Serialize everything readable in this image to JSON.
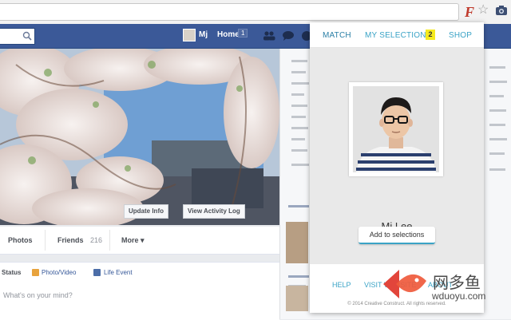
{
  "browser": {
    "extension_glyph": "F",
    "star_icon": "star-icon",
    "camera_icon": "camera-icon"
  },
  "facebook": {
    "user_name": "Mj",
    "home_label": "Home",
    "home_count": "1",
    "cover_buttons": {
      "update_info": "Update Info",
      "view_activity": "View Activity Log"
    },
    "tabs": {
      "photos": "Photos",
      "friends": "Friends",
      "friends_count": "216",
      "more": "More ▾"
    },
    "composer": {
      "status": "Status",
      "photo_video": "Photo/Video",
      "life_event": "Life Event",
      "placeholder": "What's on your mind?"
    },
    "brand_blue": "#3b5998"
  },
  "popup": {
    "nav": {
      "match": "MATCH",
      "my_selections": "MY SELECTIONS",
      "selections_count": "2",
      "shop": "SHOP"
    },
    "person_name": "Mj Lee",
    "add_button": "Add to selections",
    "footer": {
      "help": "HELP",
      "website": "VISIT WEBSITE",
      "about": "ABOUT"
    },
    "copyright": "© 2014 Creative Construct. All rights reserved.",
    "accent_color": "#3aa3c6",
    "badge_color": "#f5ea1e"
  },
  "watermark": {
    "chinese": "网多鱼",
    "url": "wduoyu.com"
  }
}
